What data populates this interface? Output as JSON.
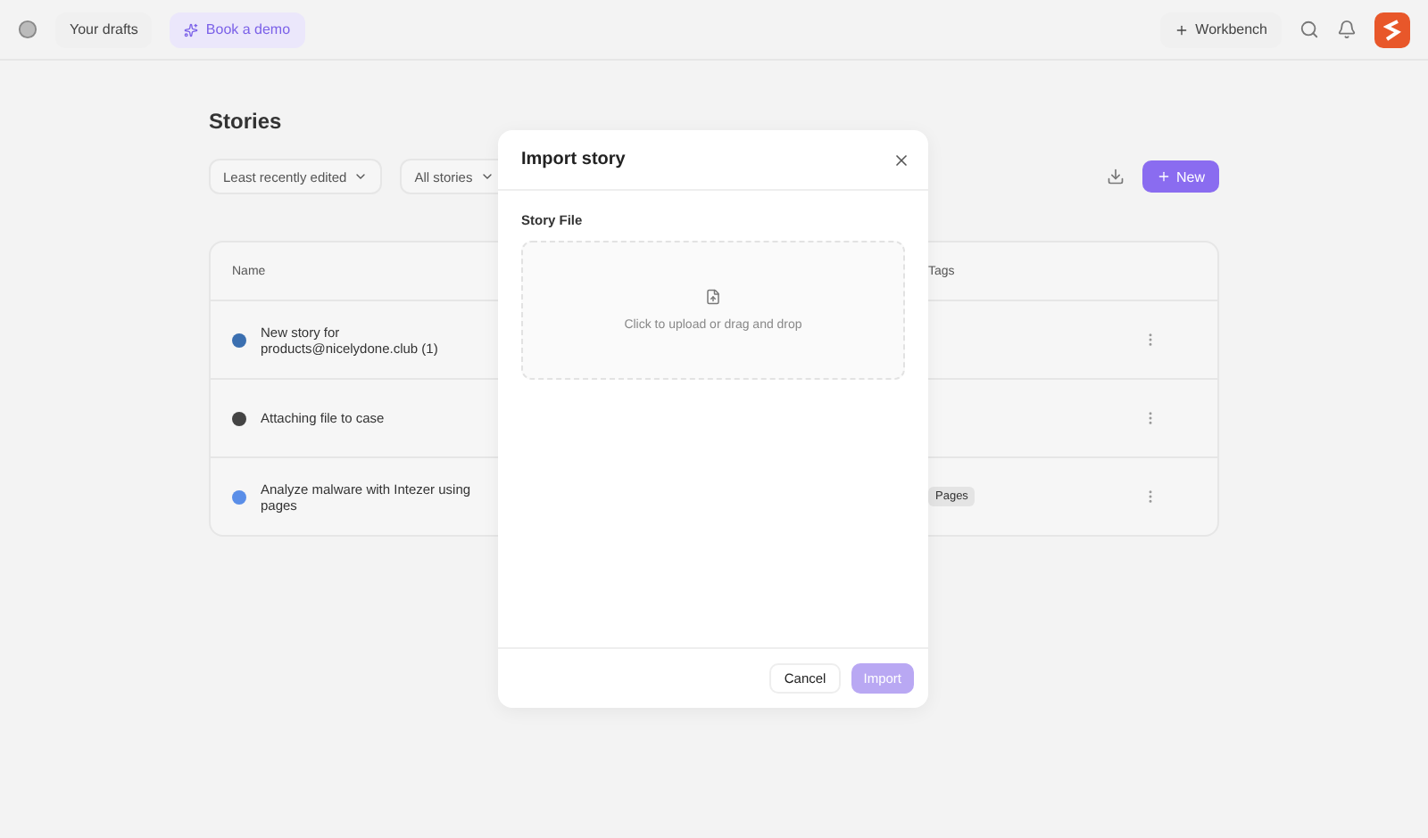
{
  "topbar": {
    "drafts_label": "Your drafts",
    "demo_button": "Book a demo",
    "workbench_button": "Workbench"
  },
  "page": {
    "title": "Stories",
    "sort_filter": "Least recently edited",
    "scope_filter": "All stories",
    "new_button": "New"
  },
  "table": {
    "columns": [
      "Name",
      "Tags"
    ],
    "rows": [
      {
        "name": "New story for products@nicelydone.club (1)",
        "color": "#3b6fb0",
        "tag": null
      },
      {
        "name": "Attaching file to case",
        "color": "#444444",
        "tag": null
      },
      {
        "name": "Analyze malware with Intezer using pages",
        "color": "#5a8ee8",
        "tag": "Pages"
      }
    ]
  },
  "dialog": {
    "title": "Import story",
    "field_label": "Story File",
    "dropzone_text": "Click to upload or drag and drop",
    "cancel_button": "Cancel",
    "import_button": "Import",
    "import_disabled": true
  }
}
